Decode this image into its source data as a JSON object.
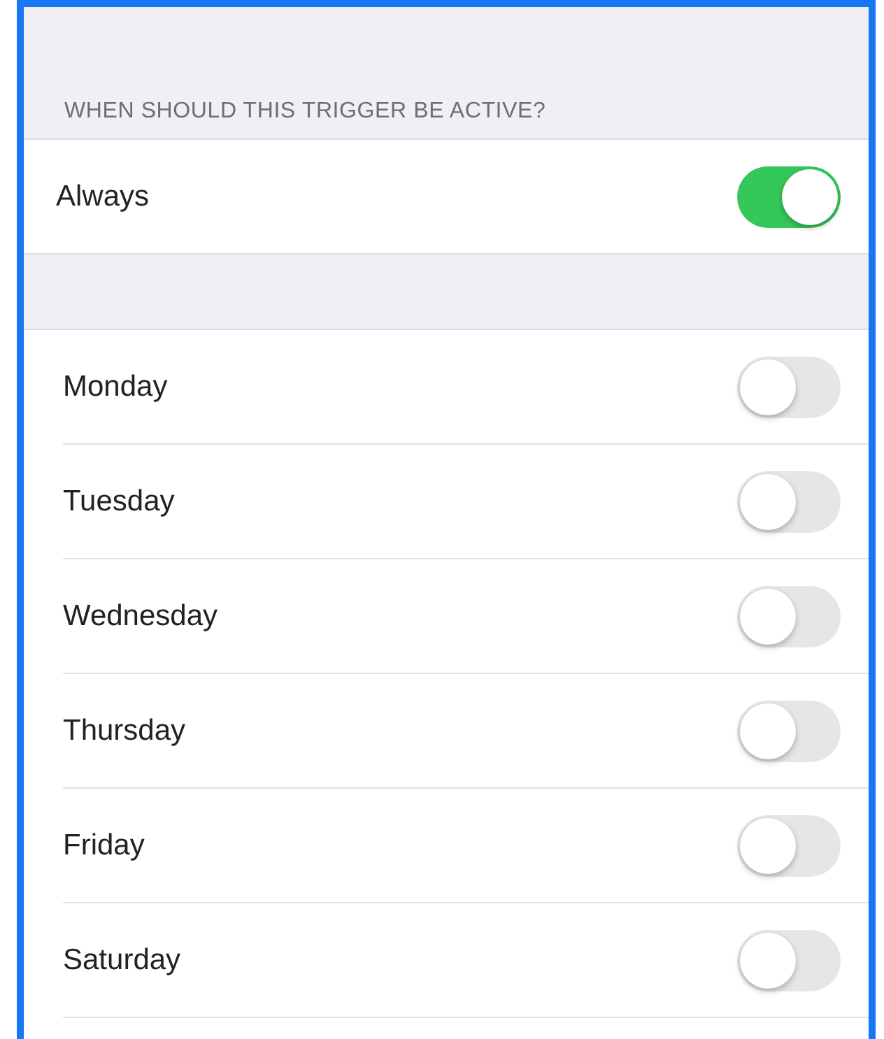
{
  "section_header": "WHEN SHOULD THIS TRIGGER BE ACTIVE?",
  "always": {
    "label": "Always",
    "on": true
  },
  "days": [
    {
      "label": "Monday",
      "on": false
    },
    {
      "label": "Tuesday",
      "on": false
    },
    {
      "label": "Wednesday",
      "on": false
    },
    {
      "label": "Thursday",
      "on": false
    },
    {
      "label": "Friday",
      "on": false
    },
    {
      "label": "Saturday",
      "on": false
    }
  ]
}
